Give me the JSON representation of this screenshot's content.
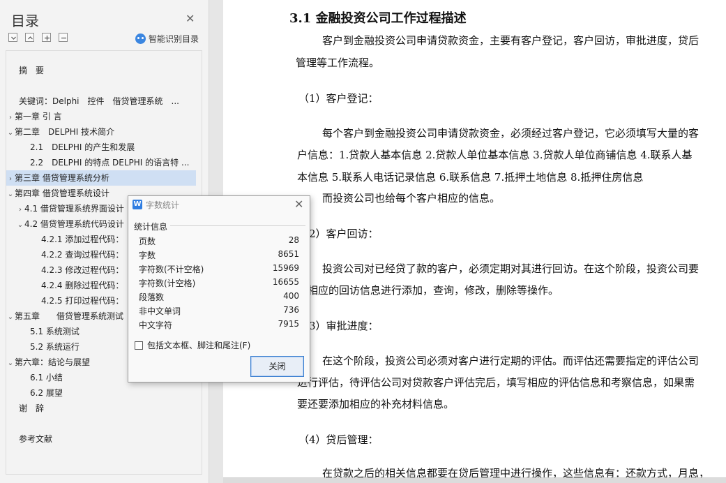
{
  "sidebar": {
    "title": "目录",
    "smart_label": "智能识别目录",
    "items": [
      {
        "label": "摘　要",
        "chev": ""
      },
      {
        "label": "关键词：Delphi　控件　借贷管理系统　...",
        "chev": ""
      },
      {
        "label": "第一章 引 言",
        "chev": "›"
      },
      {
        "label": "第二章　DELPHI 技术简介",
        "chev": "⌄"
      },
      {
        "label": "2.1　DELPHI 的产生和发展",
        "chev": ""
      },
      {
        "label": "2.2　DELPHI 的特点 DELPHI 的语言特 ...",
        "chev": ""
      },
      {
        "label": "第三章 借贷管理系统分析",
        "chev": "›"
      },
      {
        "label": "第四章 借贷管理系统设计",
        "chev": "⌄"
      },
      {
        "label": "4.1 借贷管理系统界面设计",
        "chev": "›"
      },
      {
        "label": "4.2 借贷管理系统代码设计",
        "chev": "⌄"
      },
      {
        "label": "4.2.1 添加过程代码：",
        "chev": ""
      },
      {
        "label": "4.2.2 查询过程代码：",
        "chev": ""
      },
      {
        "label": "4.2.3 修改过程代码：",
        "chev": ""
      },
      {
        "label": "4.2.4 删除过程代码：",
        "chev": ""
      },
      {
        "label": "4.2.5 打印过程代码：",
        "chev": ""
      },
      {
        "label": "第五章　　借贷管理系统测试",
        "chev": "⌄"
      },
      {
        "label": "5.1 系统测试",
        "chev": ""
      },
      {
        "label": "5.2 系统运行",
        "chev": ""
      },
      {
        "label": "第六章：结论与展望",
        "chev": "⌄"
      },
      {
        "label": "6.1 小结",
        "chev": ""
      },
      {
        "label": "6.2 展望",
        "chev": ""
      },
      {
        "label": "谢　辞",
        "chev": ""
      },
      {
        "label": "参考文献",
        "chev": ""
      }
    ]
  },
  "document": {
    "heading": "3.1 金融投资公司工作过程描述",
    "paragraphs": [
      "客户到金融投资公司申请贷款资金，主要有客户登记，客户回访，审批进度，贷后",
      "管理等工作流程。",
      "（1）客户登记：",
      "每个客户到金融投资公司申请贷款资金，必须经过客户登记，它必须填写大量的客",
      "户信息：1.贷款人基本信息 2.贷款人单位基本信息 3.贷款人单位商铺信息 4.联系人基",
      "本信息 5.联系人电话记录信息 6.联系信息 7.抵押土地信息 8.抵押住房信息",
      "而投资公司也给每个客户相应的信息。",
      "（2）客户回访：",
      "投资公司对已经贷了款的客户，必须定期对其进行回访。在这个阶段，投资公司要",
      "对相应的回访信息进行添加，查询，修改，删除等操作。",
      "（3）审批进度：",
      "在这个阶段，投资公司必须对客户进行定期的评估。而评估还需要指定的评估公司",
      "进行评估，待评估公司对贷款客户评估完后，填写相应的评估信息和考察信息，如果需",
      "要还要添加相应的补充材料信息。",
      "（4）贷后管理：",
      "在贷款之后的相关信息都要在贷后管理中进行操作，这些信息有：还款方式，月息，"
    ]
  },
  "dialog": {
    "title": "字数统计",
    "group_label": "统计信息",
    "stats": [
      {
        "label": "页数",
        "value": "28"
      },
      {
        "label": "字数",
        "value": "8651"
      },
      {
        "label": "字符数(不计空格)",
        "value": "15969"
      },
      {
        "label": "字符数(计空格)",
        "value": "16655"
      },
      {
        "label": "段落数",
        "value": "400"
      },
      {
        "label": "非中文单词",
        "value": "736"
      },
      {
        "label": "中文字符",
        "value": "7915"
      }
    ],
    "checkbox_label": "包括文本框、脚注和尾注(F)",
    "close_label": "关闭"
  }
}
